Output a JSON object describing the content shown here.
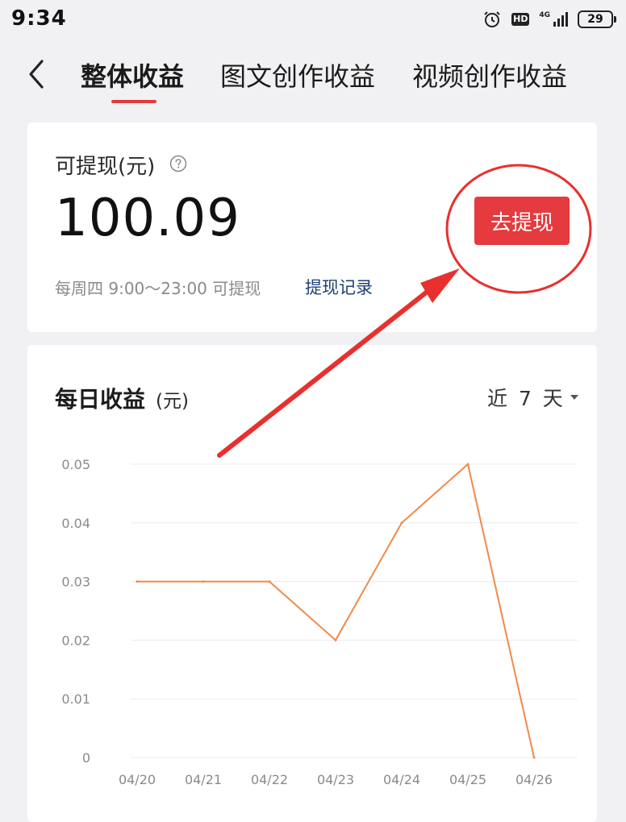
{
  "status_bar": {
    "time": "9:34",
    "hd_label": "HD",
    "network_label": "4G",
    "battery": "29",
    "icons": [
      "alarm-icon",
      "hd-icon",
      "signal-icon",
      "battery-icon"
    ]
  },
  "nav": {
    "tabs": [
      {
        "label": "整体收益",
        "active": true
      },
      {
        "label": "图文创作收益",
        "active": false
      },
      {
        "label": "视频创作收益",
        "active": false
      }
    ],
    "accent_color": "#e33a3c"
  },
  "withdraw": {
    "label": "可提现(元)",
    "amount": "100.09",
    "button_label": "去提现",
    "hint": "每周四 9:00～23:00 可提现",
    "record_link": "提现记录",
    "button_color": "#e53a3e"
  },
  "daily": {
    "title": "每日收益",
    "unit": "(元)",
    "range_label": "近 7 天"
  },
  "chart_data": {
    "type": "line",
    "categories": [
      "04/20",
      "04/21",
      "04/22",
      "04/23",
      "04/24",
      "04/25",
      "04/26"
    ],
    "values": [
      0.03,
      0.03,
      0.03,
      0.02,
      0.04,
      0.05,
      0
    ],
    "yticks": [
      "0.05",
      "0.04",
      "0.03",
      "0.02",
      "0.01",
      "0"
    ],
    "ylim": [
      0,
      0.05
    ],
    "grid": true,
    "line_color": "#f08a4b",
    "title": "每日收益(元)"
  },
  "annotation": {
    "color": "#e8302e"
  }
}
